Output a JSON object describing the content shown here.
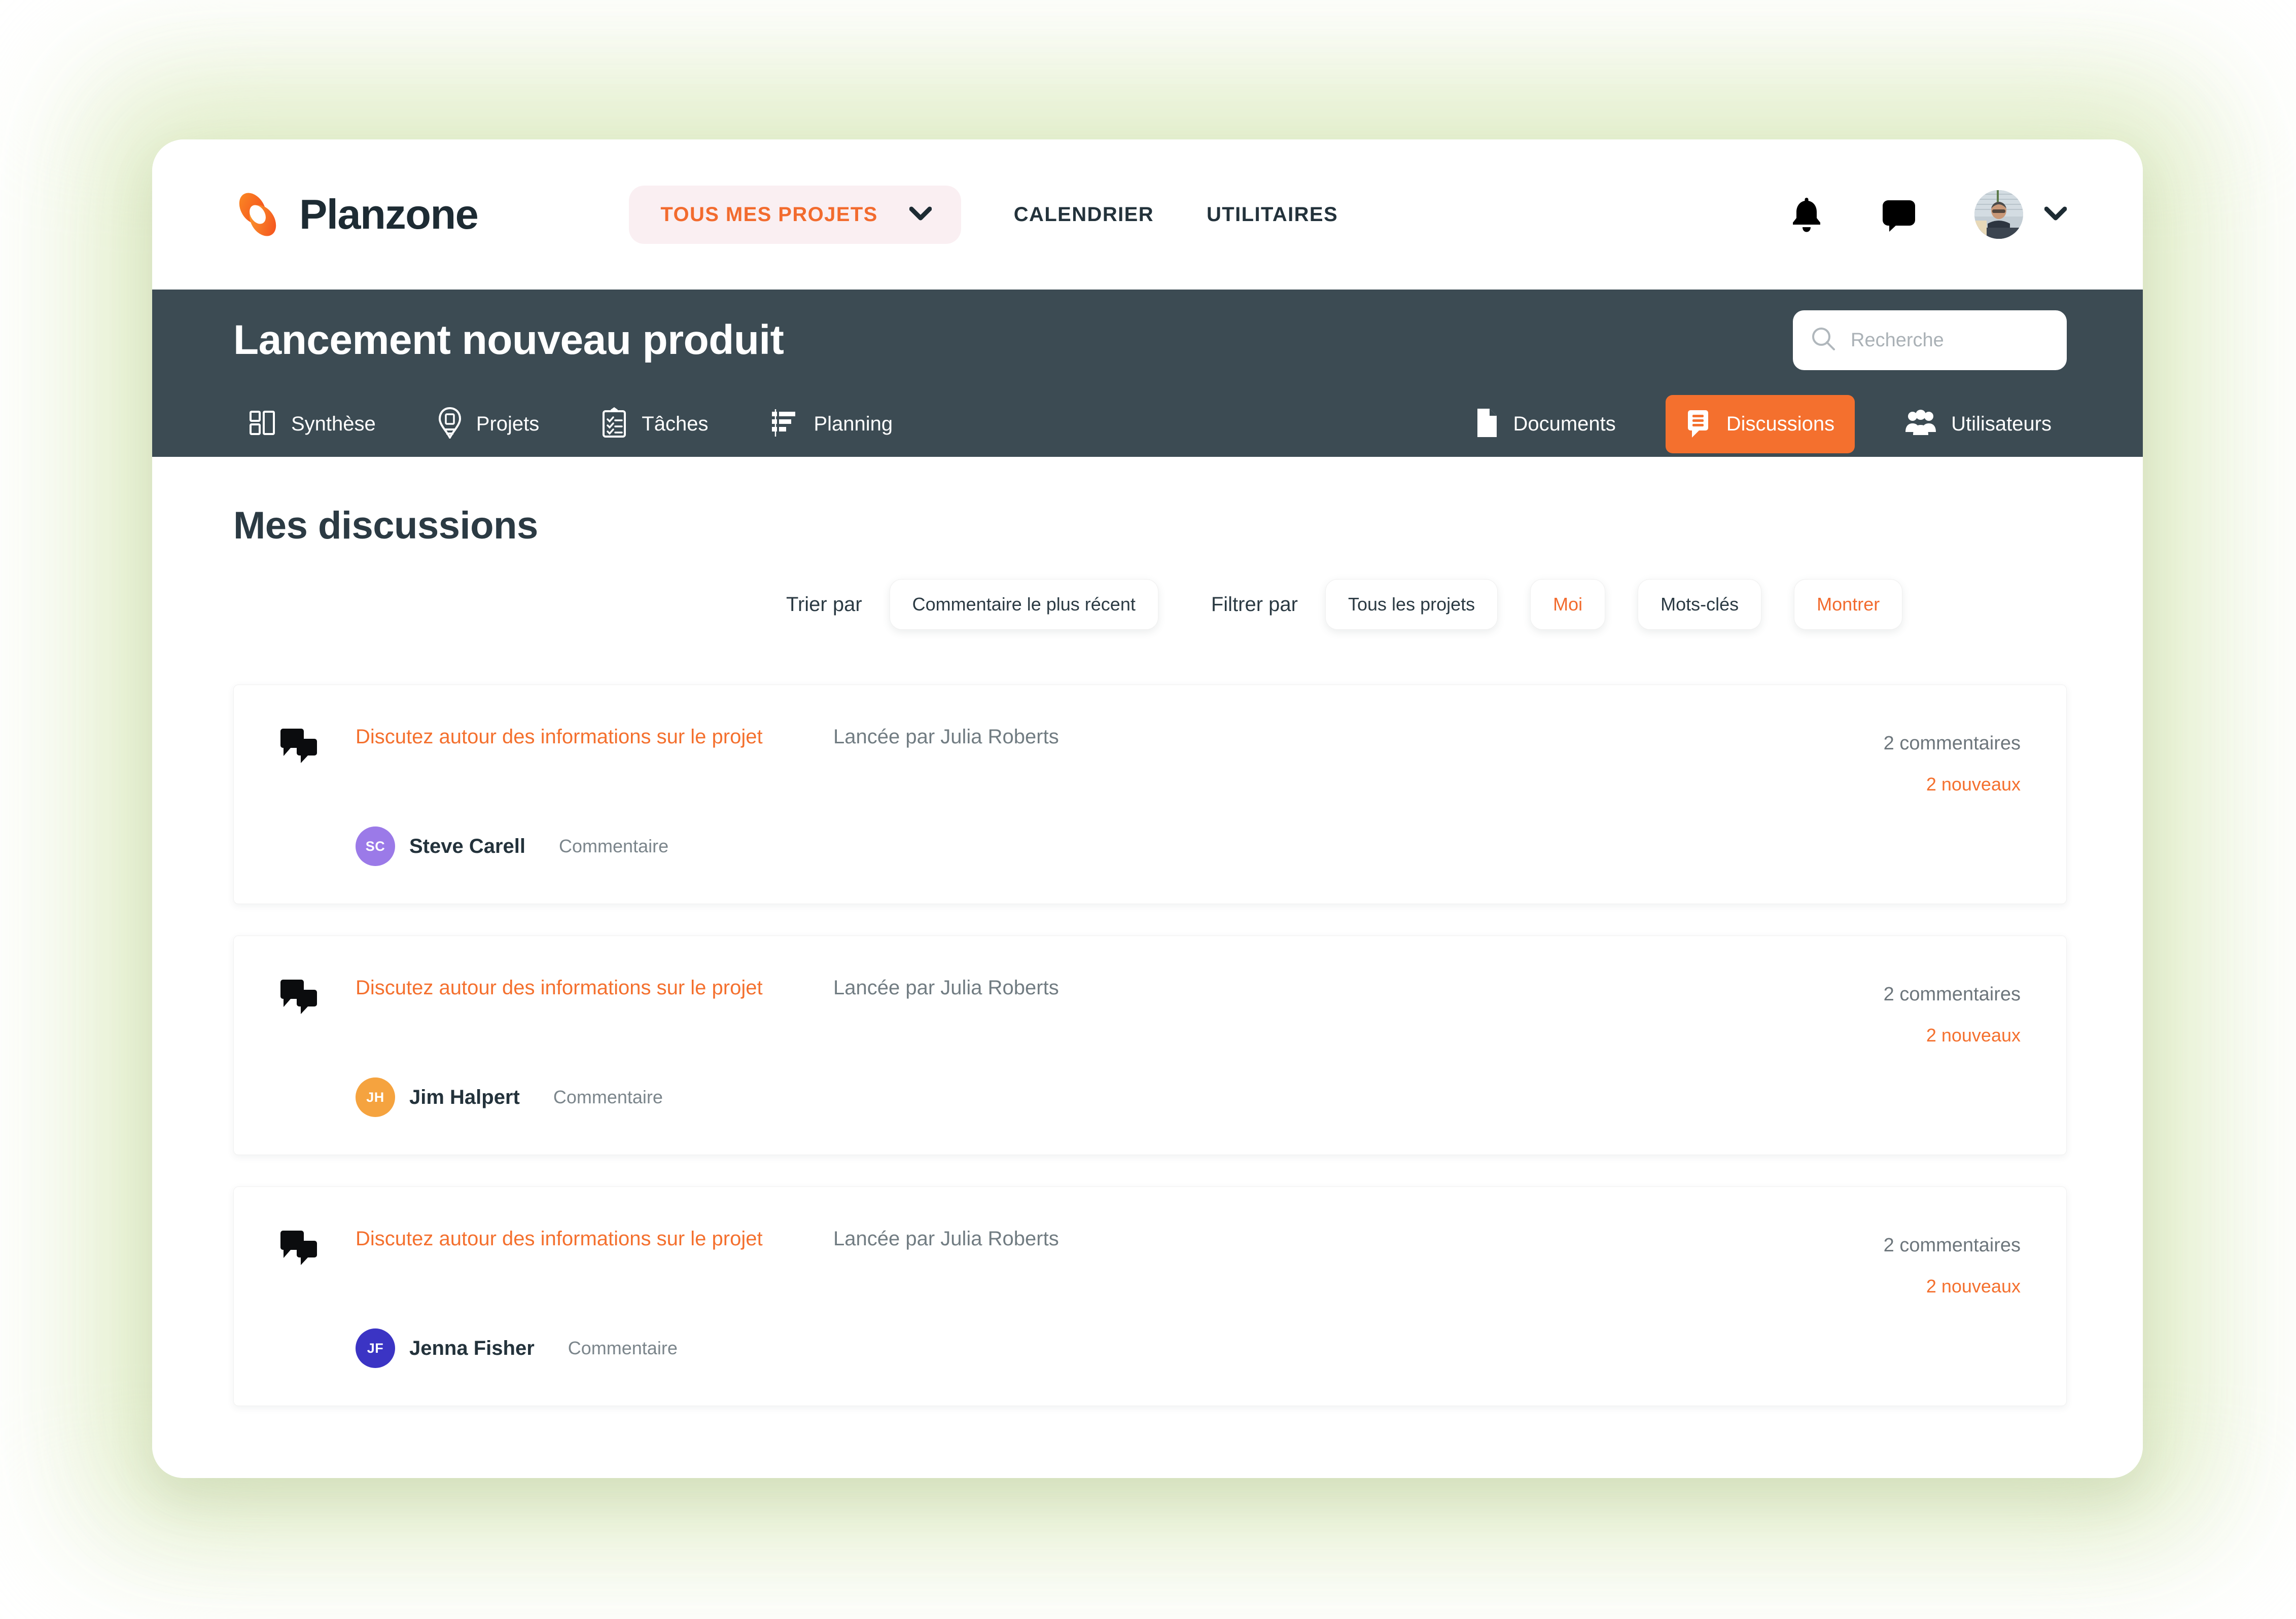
{
  "brand": {
    "name": "Planzone",
    "logo_icon": "planzone-logo-icon"
  },
  "topnav": {
    "projects_selector": {
      "label": "TOUS MES PROJETS",
      "chevron_icon": "chevron-down-icon"
    },
    "links": [
      {
        "label": "CALENDRIER",
        "name": "calendrier"
      },
      {
        "label": "UTILITAIRES",
        "name": "utilitaires"
      }
    ],
    "notifications_icon": "bell-icon",
    "messages_icon": "chat-bubble-icon",
    "avatar_icon": "user-avatar-photo",
    "avatar_chevron_icon": "chevron-down-icon"
  },
  "project_header": {
    "title": "Lancement nouveau produit",
    "search": {
      "placeholder": "Recherche",
      "value": "",
      "icon": "search-icon"
    },
    "tabs_left": [
      {
        "label": "Synthèse",
        "icon": "dashboard-icon",
        "active": false
      },
      {
        "label": "Projets",
        "icon": "project-pin-icon",
        "active": false
      },
      {
        "label": "Tâches",
        "icon": "clipboard-checklist-icon",
        "active": false
      },
      {
        "label": "Planning",
        "icon": "gantt-chart-icon",
        "active": false
      }
    ],
    "tabs_right": [
      {
        "label": "Documents",
        "icon": "document-icon",
        "active": false
      },
      {
        "label": "Discussions",
        "icon": "discussion-icon",
        "active": true
      },
      {
        "label": "Utilisateurs",
        "icon": "users-icon",
        "active": false
      }
    ]
  },
  "main": {
    "page_title": "Mes discussions",
    "filters": {
      "sort_label": "Trier par",
      "sort_value": "Commentaire le plus récent",
      "filter_label": "Filtrer par",
      "filter_projects": "Tous les projets",
      "filter_me": "Moi",
      "filter_keywords": "Mots-clés",
      "show_button": "Montrer"
    },
    "discussions": [
      {
        "subject": "Discutez autour des informations sur le projet",
        "starter": "Lancée par Julia Roberts",
        "comments_total": "2 commentaires",
        "comments_new": "2 nouveaux",
        "author": "Steve Carell",
        "author_initials": "SC",
        "author_color": "#9b7ae8",
        "action": "Commentaire",
        "icon": "discussion-bubbles-icon"
      },
      {
        "subject": "Discutez autour des informations sur le projet",
        "starter": "Lancée par Julia Roberts",
        "comments_total": "2 commentaires",
        "comments_new": "2 nouveaux",
        "author": "Jim Halpert",
        "author_initials": "JH",
        "author_color": "#f5a33f",
        "action": "Commentaire",
        "icon": "discussion-bubbles-icon"
      },
      {
        "subject": "Discutez autour des informations sur le projet",
        "starter": "Lancée par Julia Roberts",
        "comments_total": "2 commentaires",
        "comments_new": "2 nouveaux",
        "author": "Jenna Fisher",
        "author_initials": "JF",
        "author_color": "#3b34c4",
        "action": "Commentaire",
        "icon": "discussion-bubbles-icon"
      }
    ]
  },
  "colors": {
    "accent_orange": "#f4702e",
    "header_dark": "#3c4b53",
    "text_dark": "#23323b",
    "text_muted": "#717c82",
    "glow_green": "#e6f0d2"
  }
}
